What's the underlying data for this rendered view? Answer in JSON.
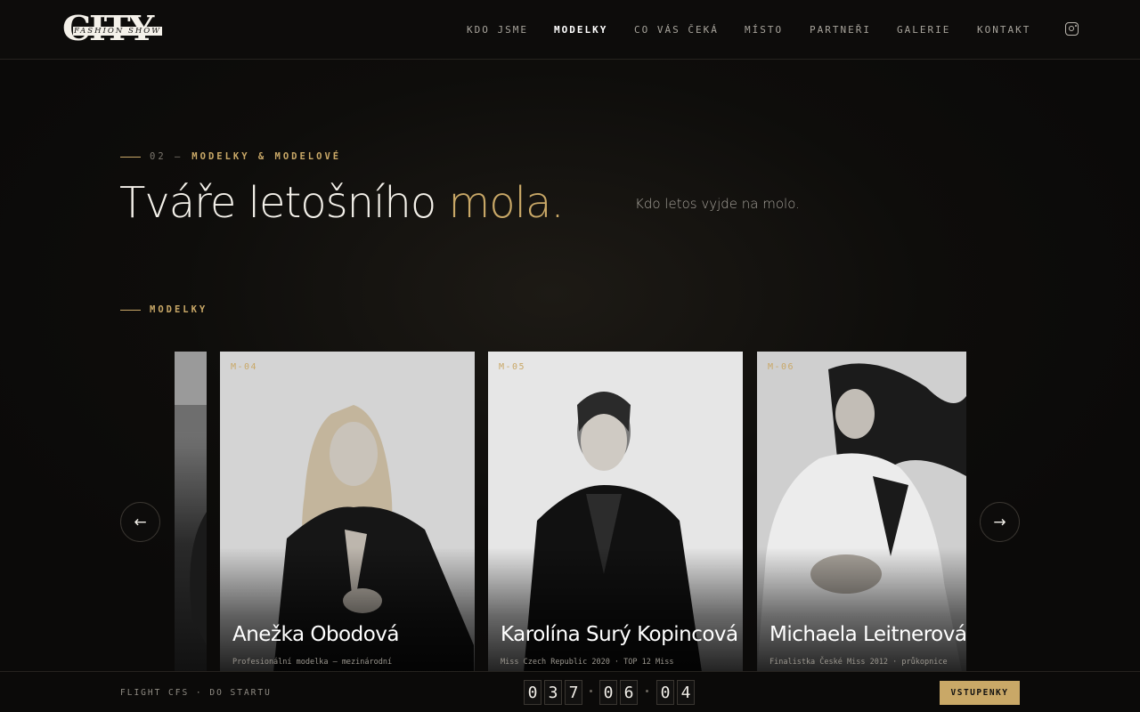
{
  "header": {
    "logo_text": "CITY",
    "logo_sub": "FASHION SHOW",
    "nav": [
      {
        "label": "KDO JSME",
        "active": false
      },
      {
        "label": "MODELKY",
        "active": true
      },
      {
        "label": "CO VÁS ČEKÁ",
        "active": false
      },
      {
        "label": "MÍSTO",
        "active": false
      },
      {
        "label": "PARTNEŘI",
        "active": false
      },
      {
        "label": "GALERIE",
        "active": false
      },
      {
        "label": "KONTAKT",
        "active": false
      }
    ],
    "social_icon": "instagram-icon"
  },
  "section": {
    "number": "02 —",
    "eyebrow": "MODELKY & MODELOVÉ",
    "title_main": "Tváře letošního ",
    "title_accent": "mola.",
    "subtitle": "Kdo letos vyjde na molo.",
    "group_label": "MODELKY"
  },
  "carousel": {
    "prev_arrow": "←",
    "next_arrow": "→",
    "cards": [
      {
        "code": "",
        "name": "",
        "desc": ""
      },
      {
        "code": "M-04",
        "name": "Anežka Obodová",
        "desc": "Profesionální modelka — mezinárodní"
      },
      {
        "code": "M-05",
        "name": "Karolína Surý Kopincová",
        "desc": "Miss Czech Republic 2020 · TOP 12 Miss"
      },
      {
        "code": "M-06",
        "name": "Michaela Leitnerová",
        "desc": "Finalistka České Miss 2012 · průkopnice"
      }
    ]
  },
  "footer": {
    "flight_label": "FLIGHT CFS · DO STARTU",
    "countdown": [
      "0",
      "3",
      "7",
      "0",
      "6",
      "0",
      "4"
    ],
    "ticket_button": "VSTUPENKY"
  },
  "colors": {
    "accent": "#c9a867",
    "background": "#0b0a09"
  }
}
